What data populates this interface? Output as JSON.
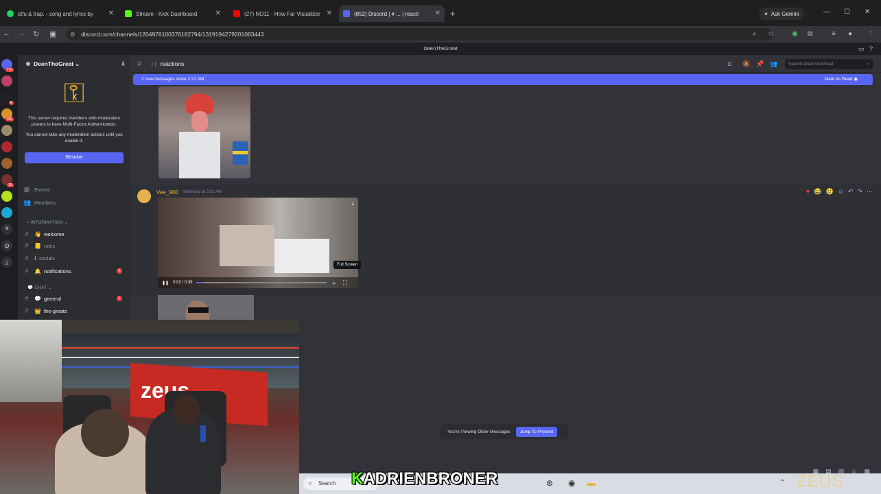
{
  "browser": {
    "tabs": [
      {
        "title": "stfu & trap. - song and lyrics by",
        "favicon_color": "#1ed760"
      },
      {
        "title": "Stream - Kick Dashboard",
        "favicon_color": "#53fc18"
      },
      {
        "title": "(27) NO11 - How Far Visualizer",
        "favicon_color": "#ff0000"
      },
      {
        "title": "(852) Discord | # ... | reacti",
        "favicon_color": "#5865f2"
      }
    ],
    "ask_gemini": "Ask Gemini",
    "url": "discord.com/channels/1204976100376182794/1319194279201083443"
  },
  "discord": {
    "window_title": "DeenTheGreat",
    "server_name": "DeenTheGreat",
    "mfa_text": "This server requires members with moderation powers to have Multi-Factor Authentication.",
    "mfa_text2": "You cannot take any moderation actions until you enable it.",
    "resolve_label": "Resolve",
    "nav": [
      "Events",
      "Members"
    ],
    "category_info": "INFORMATION",
    "category_chat": "CHAT",
    "channels": [
      {
        "name": "welcome",
        "emoji": "👋"
      },
      {
        "name": "rules",
        "emoji": "📒"
      },
      {
        "name": "socials",
        "emoji": "ℹ"
      },
      {
        "name": "notifications",
        "emoji": "🔔"
      },
      {
        "name": "general",
        "emoji": "💬"
      },
      {
        "name": "the-greats",
        "emoji": "👑"
      }
    ],
    "channel_title": "reactions",
    "search_placeholder": "Search DeenTheGreat",
    "new_messages": "2 new messages since 2:21 AM",
    "mark_as_read": "Mark As Read",
    "author": "Vee_900",
    "timestamp": "Yesterday at 3:31 AM",
    "video_time": "0:02 / 0:39",
    "fullscreen_tooltip": "Full Screen",
    "older_messages": "You're Viewing Older Messages",
    "jump_to_present": "Jump To Present"
  },
  "stream": {
    "banner_text": "zeus",
    "overlay_k": "K",
    "overlay_name": "ADRIENBRONER",
    "watermark": "ZEUS"
  },
  "taskbar": {
    "search_placeholder": "Search"
  },
  "colors": {
    "blurple": "#5865f2",
    "kick_green": "#53fc18",
    "notif_red": "#f23f43"
  }
}
